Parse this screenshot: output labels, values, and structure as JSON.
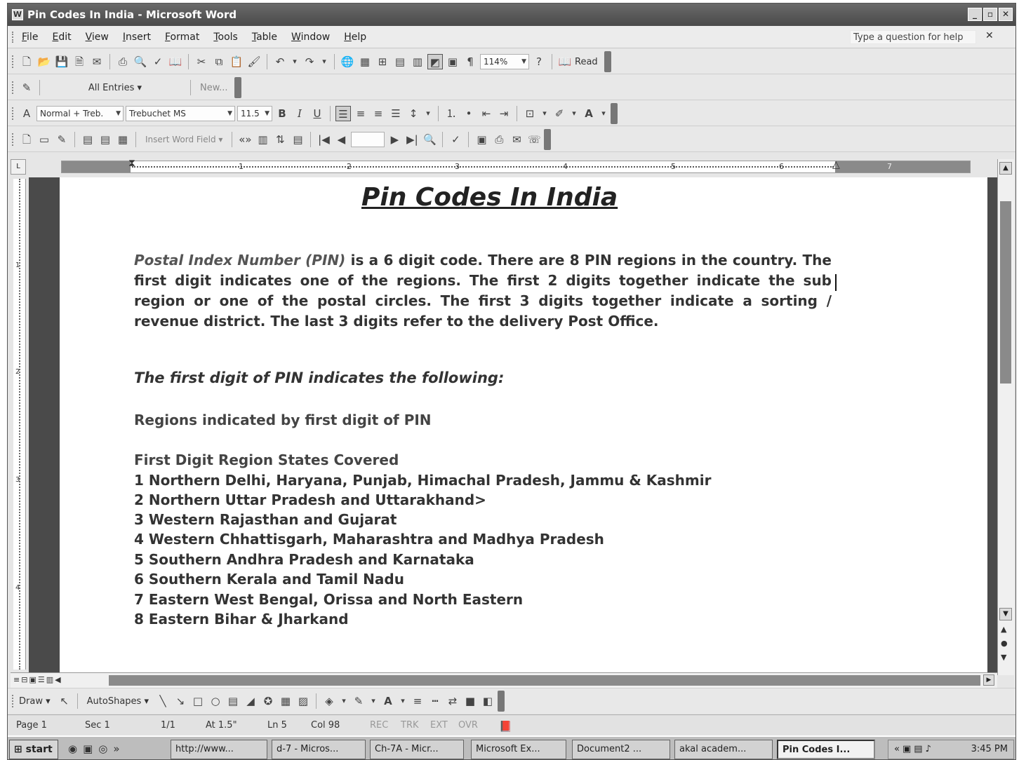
{
  "window": {
    "title": "Pin Codes In India - Microsoft Word",
    "controls": [
      "_",
      "▫",
      "✕"
    ]
  },
  "menu": {
    "items": [
      "File",
      "Edit",
      "View",
      "Insert",
      "Format",
      "Tools",
      "Table",
      "Window",
      "Help"
    ],
    "help_placeholder": "Type a question for help",
    "close_doc": "✕"
  },
  "standard_toolbar": {
    "zoom": "114%",
    "read_label": "Read"
  },
  "autotext_toolbar": {
    "entries_label": "All Entries",
    "new_label": "New..."
  },
  "formatting_toolbar": {
    "style": "Normal + Treb.",
    "font": "Trebuchet MS",
    "size": "11.5",
    "bold": "B",
    "italic": "I",
    "underline": "U"
  },
  "mailmerge_toolbar": {
    "insert_word_field": "Insert Word Field"
  },
  "ruler": {
    "numbers": [
      "1",
      "2",
      "3",
      "4",
      "5",
      "6",
      "7"
    ],
    "v_numbers": [
      "1",
      "2",
      "3",
      "4"
    ]
  },
  "document": {
    "title": "Pin Codes In India",
    "para_term": "Postal Index Number (PIN)",
    "para_rest": " is a 6 digit code. There are 8 PIN regions in the country. The first digit indicates one of the regions. The first 2 digits together indicate the sub region or one of the postal circles. The first 3 digits together indicate a sorting / revenue district. The last 3 digits refer to the delivery Post Office.",
    "subhead": "The first digit of PIN indicates the following:",
    "regions_heading": "Regions indicated by first digit of PIN",
    "table_header": "First Digit Region States Covered",
    "rows": [
      "1 Northern Delhi, Haryana, Punjab, Himachal Pradesh, Jammu & Kashmir",
      "2 Northern Uttar Pradesh and Uttarakhand>",
      "3 Western Rajasthan and Gujarat",
      "4 Western Chhattisgarh, Maharashtra and Madhya Pradesh",
      "5 Southern Andhra Pradesh and Karnataka",
      "6 Southern Kerala and Tamil Nadu",
      "7 Eastern West Bengal, Orissa and North Eastern",
      "8 Eastern Bihar & Jharkand"
    ]
  },
  "drawing_toolbar": {
    "draw_label": "Draw",
    "autoshapes_label": "AutoShapes"
  },
  "status": {
    "page": "Page 1",
    "sec": "Sec 1",
    "pages": "1/1",
    "at": "At 1.5\"",
    "ln": "Ln 5",
    "col": "Col 98",
    "rec": "REC",
    "trk": "TRK",
    "ext": "EXT",
    "ovr": "OVR"
  },
  "taskbar": {
    "start": "start",
    "tasks": [
      "http://www...",
      "d-7 - Micros...",
      "Ch-7A - Micr...",
      "Microsoft Ex...",
      "Document2 ...",
      "akal academ...",
      "Pin Codes I..."
    ],
    "clock": "3:45 PM"
  }
}
